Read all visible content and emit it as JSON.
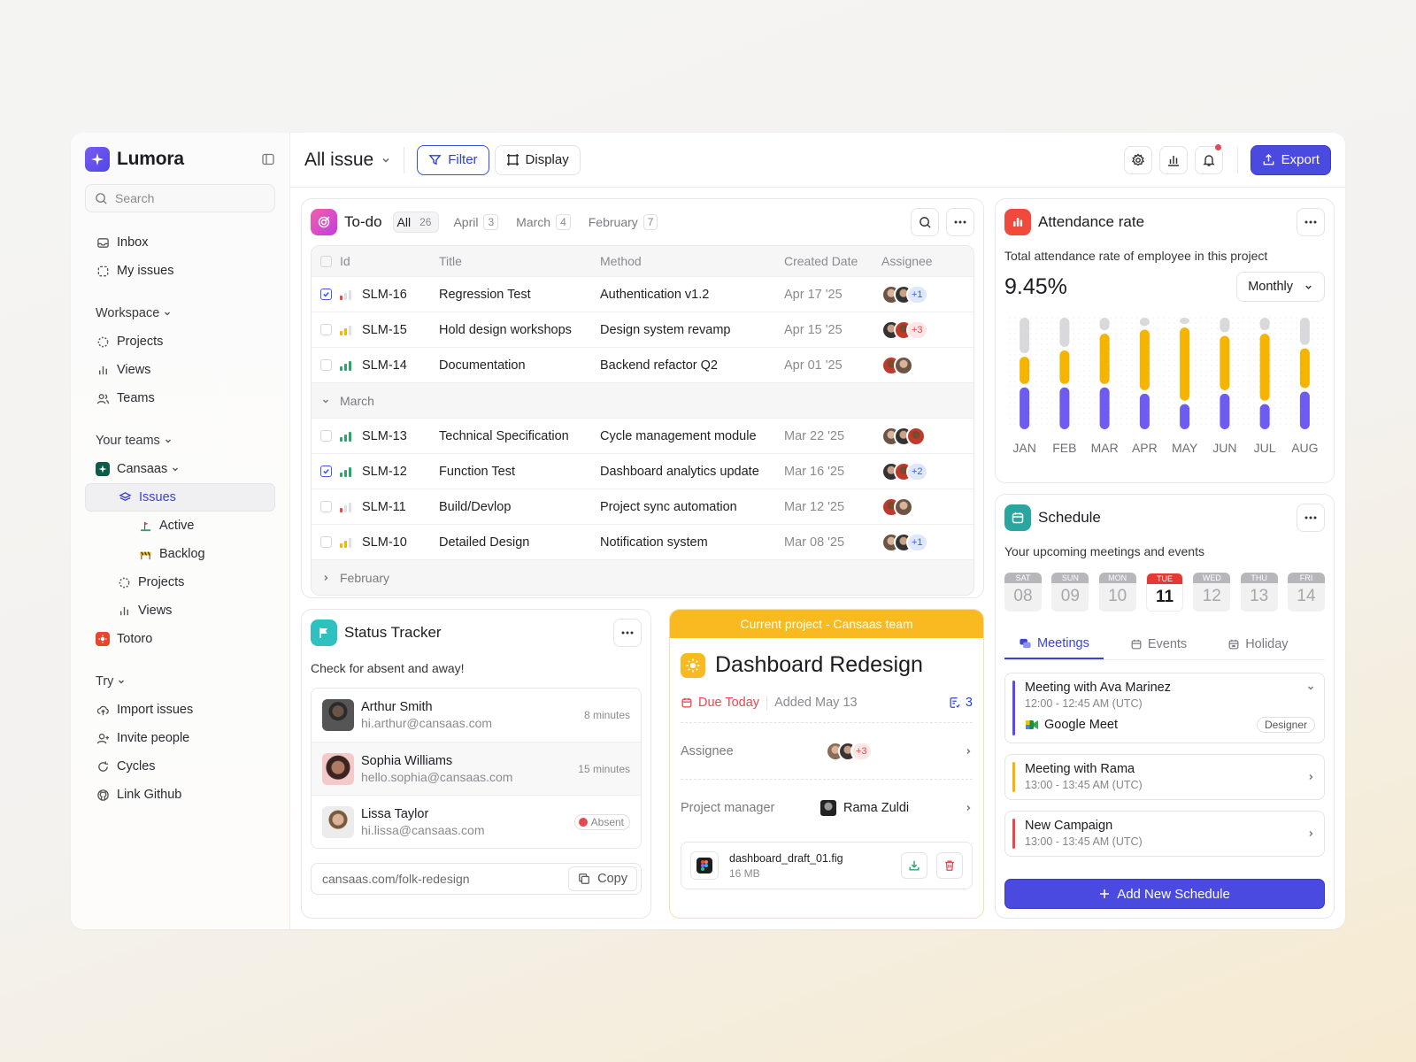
{
  "app": {
    "name": "Lumora"
  },
  "sidebar": {
    "search_placeholder": "Search",
    "top_items": [
      {
        "label": "Inbox",
        "icon": "inbox-icon"
      },
      {
        "label": "My issues",
        "icon": "dashed-square-icon"
      }
    ],
    "workspace": {
      "label": "Workspace",
      "items": [
        {
          "label": "Projects",
          "icon": "dotted-circle-icon"
        },
        {
          "label": "Views",
          "icon": "bar-chart-icon"
        },
        {
          "label": "Teams",
          "icon": "users-icon"
        }
      ]
    },
    "your_teams": {
      "label": "Your teams",
      "team": "Cansaas",
      "items": [
        {
          "label": "Issues"
        },
        {
          "label": "Active"
        },
        {
          "label": "Backlog"
        },
        {
          "label": "Projects"
        },
        {
          "label": "Views"
        }
      ],
      "other_team": "Totoro"
    },
    "try": {
      "label": "Try",
      "items": [
        {
          "label": "Import issues"
        },
        {
          "label": "Invite people"
        },
        {
          "label": "Cycles"
        },
        {
          "label": "Link Github"
        }
      ]
    }
  },
  "topbar": {
    "title": "All issue",
    "filter_label": "Filter",
    "display_label": "Display",
    "export_label": "Export"
  },
  "todo": {
    "title": "To-do",
    "tabs": [
      {
        "label": "All",
        "count": "26"
      },
      {
        "label": "April",
        "count": "3"
      },
      {
        "label": "March",
        "count": "4"
      },
      {
        "label": "February",
        "count": "7"
      }
    ],
    "columns": {
      "id": "Id",
      "title": "Title",
      "method": "Method",
      "created": "Created Date",
      "assignee": "Assignee"
    },
    "rows": [
      {
        "id": "SLM-16",
        "title": "Regression Test",
        "method": "Authentication v1.2",
        "date": "Apr 17 '25",
        "checked": true,
        "priority": "low",
        "more": "+1"
      },
      {
        "id": "SLM-15",
        "title": "Hold design workshops",
        "method": "Design system revamp",
        "date": "Apr 15 '25",
        "checked": false,
        "priority": "medium",
        "more": "+3"
      },
      {
        "id": "SLM-14",
        "title": "Documentation",
        "method": "Backend refactor Q2",
        "date": "Apr 01 '25",
        "checked": false,
        "priority": "high",
        "more": ""
      }
    ],
    "group_march": "March",
    "rows_march": [
      {
        "id": "SLM-13",
        "title": "Technical Specification",
        "method": "Cycle management module",
        "date": "Mar 22 '25",
        "checked": false,
        "priority": "high",
        "more": ""
      },
      {
        "id": "SLM-12",
        "title": "Function Test",
        "method": "Dashboard analytics update",
        "date": "Mar 16 '25",
        "checked": true,
        "priority": "high",
        "more": "+2"
      },
      {
        "id": "SLM-11",
        "title": "Build/Devlop",
        "method": "Project sync automation",
        "date": "Mar 12 '25",
        "checked": false,
        "priority": "low",
        "more": ""
      },
      {
        "id": "SLM-10",
        "title": "Detailed Design",
        "method": "Notification system",
        "date": "Mar 08 '25",
        "checked": false,
        "priority": "medium",
        "more": "+1"
      }
    ],
    "group_february": "February"
  },
  "attendance": {
    "title": "Attendance rate",
    "subtitle": "Total attendance rate of employee in this project",
    "value": "9.45%",
    "period": "Monthly",
    "months": [
      "JAN",
      "FEB",
      "MAR",
      "APR",
      "MAY",
      "JUN",
      "JUL",
      "AUG"
    ],
    "colors": {
      "gray": "#d9d9dc",
      "yellow": "#f5b400",
      "purple": "#6e5cf0"
    }
  },
  "chart_data": {
    "type": "bar",
    "categories": [
      "JAN",
      "FEB",
      "MAR",
      "APR",
      "MAY",
      "JUN",
      "JUL",
      "AUG"
    ],
    "series": [
      {
        "values": [
          34,
          28,
          12,
          8,
          6,
          14,
          12,
          26
        ]
      },
      {
        "values": [
          26,
          32,
          48,
          58,
          70,
          52,
          64,
          38
        ]
      },
      {
        "values": [
          40,
          40,
          40,
          34,
          24,
          34,
          24,
          36
        ]
      }
    ],
    "colors": [
      "#d9d9dc",
      "#f5b400",
      "#6e5cf0"
    ],
    "stacked": true
  },
  "schedule": {
    "title": "Schedule",
    "subtitle": "Your upcoming meetings and events",
    "days": [
      {
        "name": "SAT",
        "date": "08"
      },
      {
        "name": "SUN",
        "date": "09"
      },
      {
        "name": "MON",
        "date": "10"
      },
      {
        "name": "TUE",
        "date": "11",
        "today": true
      },
      {
        "name": "WED",
        "date": "12"
      },
      {
        "name": "THU",
        "date": "13"
      },
      {
        "name": "FRI",
        "date": "14"
      }
    ],
    "tabs": [
      "Meetings",
      "Events",
      "Holiday"
    ],
    "meetings": [
      {
        "title": "Meeting with Ava Marinez",
        "time": "12:00 - 12:45 AM (UTC)",
        "platform": "Google Meet",
        "tag": "Designer",
        "color": "#5b4ae8"
      },
      {
        "title": "Meeting with Rama",
        "time": "13:00 - 13:45 AM (UTC)",
        "color": "#f5b400"
      },
      {
        "title": "New Campaign",
        "time": "13:00 - 13:45 AM (UTC)",
        "color": "#e5484d"
      }
    ],
    "add_label": "Add New Schedule"
  },
  "status": {
    "title": "Status Tracker",
    "subtitle": "Check for absent and away!",
    "people": [
      {
        "name": "Arthur Smith",
        "email": "hi.arthur@cansaas.com",
        "status": "8 minutes"
      },
      {
        "name": "Sophia Williams",
        "email": "hello.sophia@cansaas.com",
        "status": "15 minutes"
      },
      {
        "name": "Lissa Taylor",
        "email": "hi.lissa@cansaas.com",
        "status": "Absent"
      }
    ],
    "link": "cansaas.com/folk-redesign",
    "copy_label": "Copy"
  },
  "project": {
    "banner": "Current project - Cansaas team",
    "title": "Dashboard Redesign",
    "due": "Due Today",
    "added": "Added May 13",
    "subtasks": "3",
    "assignee_label": "Assignee",
    "assignee_more": "+3",
    "pm_label": "Project manager",
    "pm_name": "Rama Zuldi",
    "file_name": "dashboard_draft_01.fig",
    "file_size": "16 MB"
  }
}
